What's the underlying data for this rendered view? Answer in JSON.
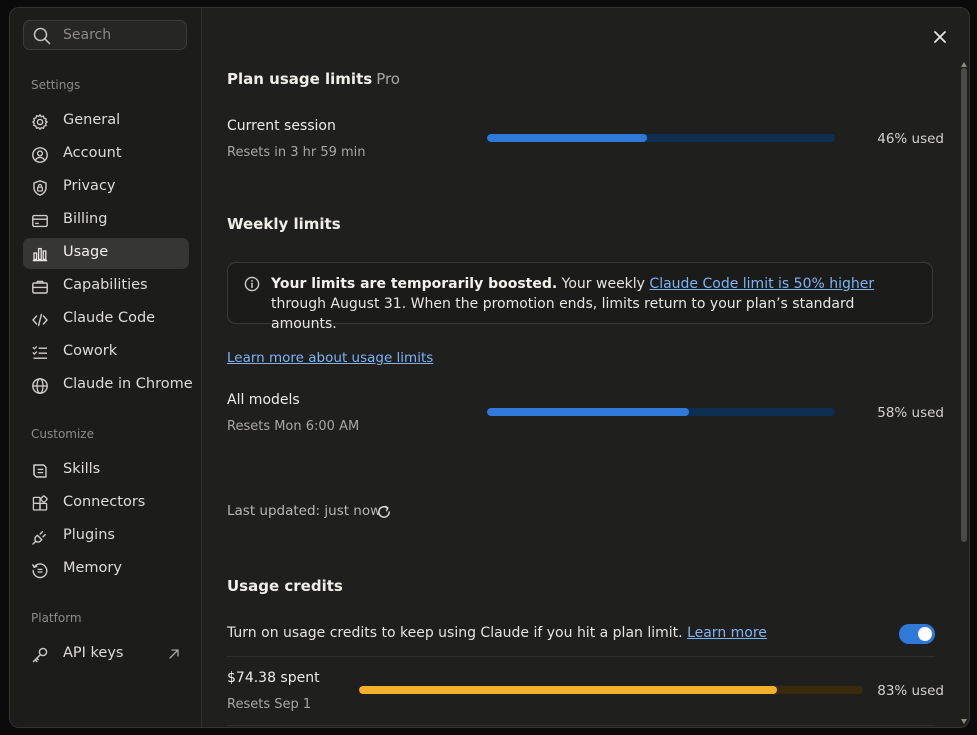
{
  "sidebar": {
    "search_placeholder": "Search",
    "sections": {
      "settings": "Settings",
      "customize": "Customize",
      "platform": "Platform"
    },
    "settings_items": [
      {
        "label": "General",
        "icon": "gear-icon"
      },
      {
        "label": "Account",
        "icon": "user-circle-icon"
      },
      {
        "label": "Privacy",
        "icon": "shield-lock-icon"
      },
      {
        "label": "Billing",
        "icon": "credit-card-icon"
      },
      {
        "label": "Usage",
        "icon": "bar-chart-icon",
        "active": true
      },
      {
        "label": "Capabilities",
        "icon": "briefcase-icon"
      },
      {
        "label": "Claude Code",
        "icon": "code-icon"
      },
      {
        "label": "Cowork",
        "icon": "checklist-icon"
      },
      {
        "label": "Claude in Chrome",
        "icon": "globe-icon"
      }
    ],
    "customize_items": [
      {
        "label": "Skills",
        "icon": "skills-icon"
      },
      {
        "label": "Connectors",
        "icon": "connectors-icon"
      },
      {
        "label": "Plugins",
        "icon": "plug-icon"
      },
      {
        "label": "Memory",
        "icon": "memory-icon"
      }
    ],
    "platform_items": [
      {
        "label": "API keys",
        "icon": "key-icon",
        "external": true
      }
    ]
  },
  "main": {
    "plan": {
      "title": "Plan usage limits",
      "tier": "Pro",
      "session": {
        "title": "Current session",
        "resets": "Resets in 3 hr 59 min",
        "percent": 46,
        "percent_label": "46% used"
      }
    },
    "weekly": {
      "title": "Weekly limits",
      "notice": {
        "bold": "Your limits are temporarily boosted.",
        "pre_link": " Your weekly ",
        "link": "Claude Code limit is 50% higher",
        "post_link": " through August 31. When the promotion ends, limits return to your plan’s standard amounts."
      },
      "learn_more": "Learn more about usage limits",
      "all_models": {
        "title": "All models",
        "resets": "Resets Mon 6:00 AM",
        "percent": 58,
        "percent_label": "58% used"
      },
      "last_updated": "Last updated: just now"
    },
    "credits": {
      "title": "Usage credits",
      "toggle_text": "Turn on usage credits to keep using Claude if you hit a plan limit.",
      "toggle_link": "Learn more",
      "toggle_on": true,
      "spent": "$74.38 spent",
      "resets": "Resets Sep 1",
      "percent": 83,
      "percent_label": "83% used"
    }
  },
  "colors": {
    "accent_blue": "#2f7ad9",
    "amber": "#f3b12b",
    "link": "#7eb3f4"
  }
}
